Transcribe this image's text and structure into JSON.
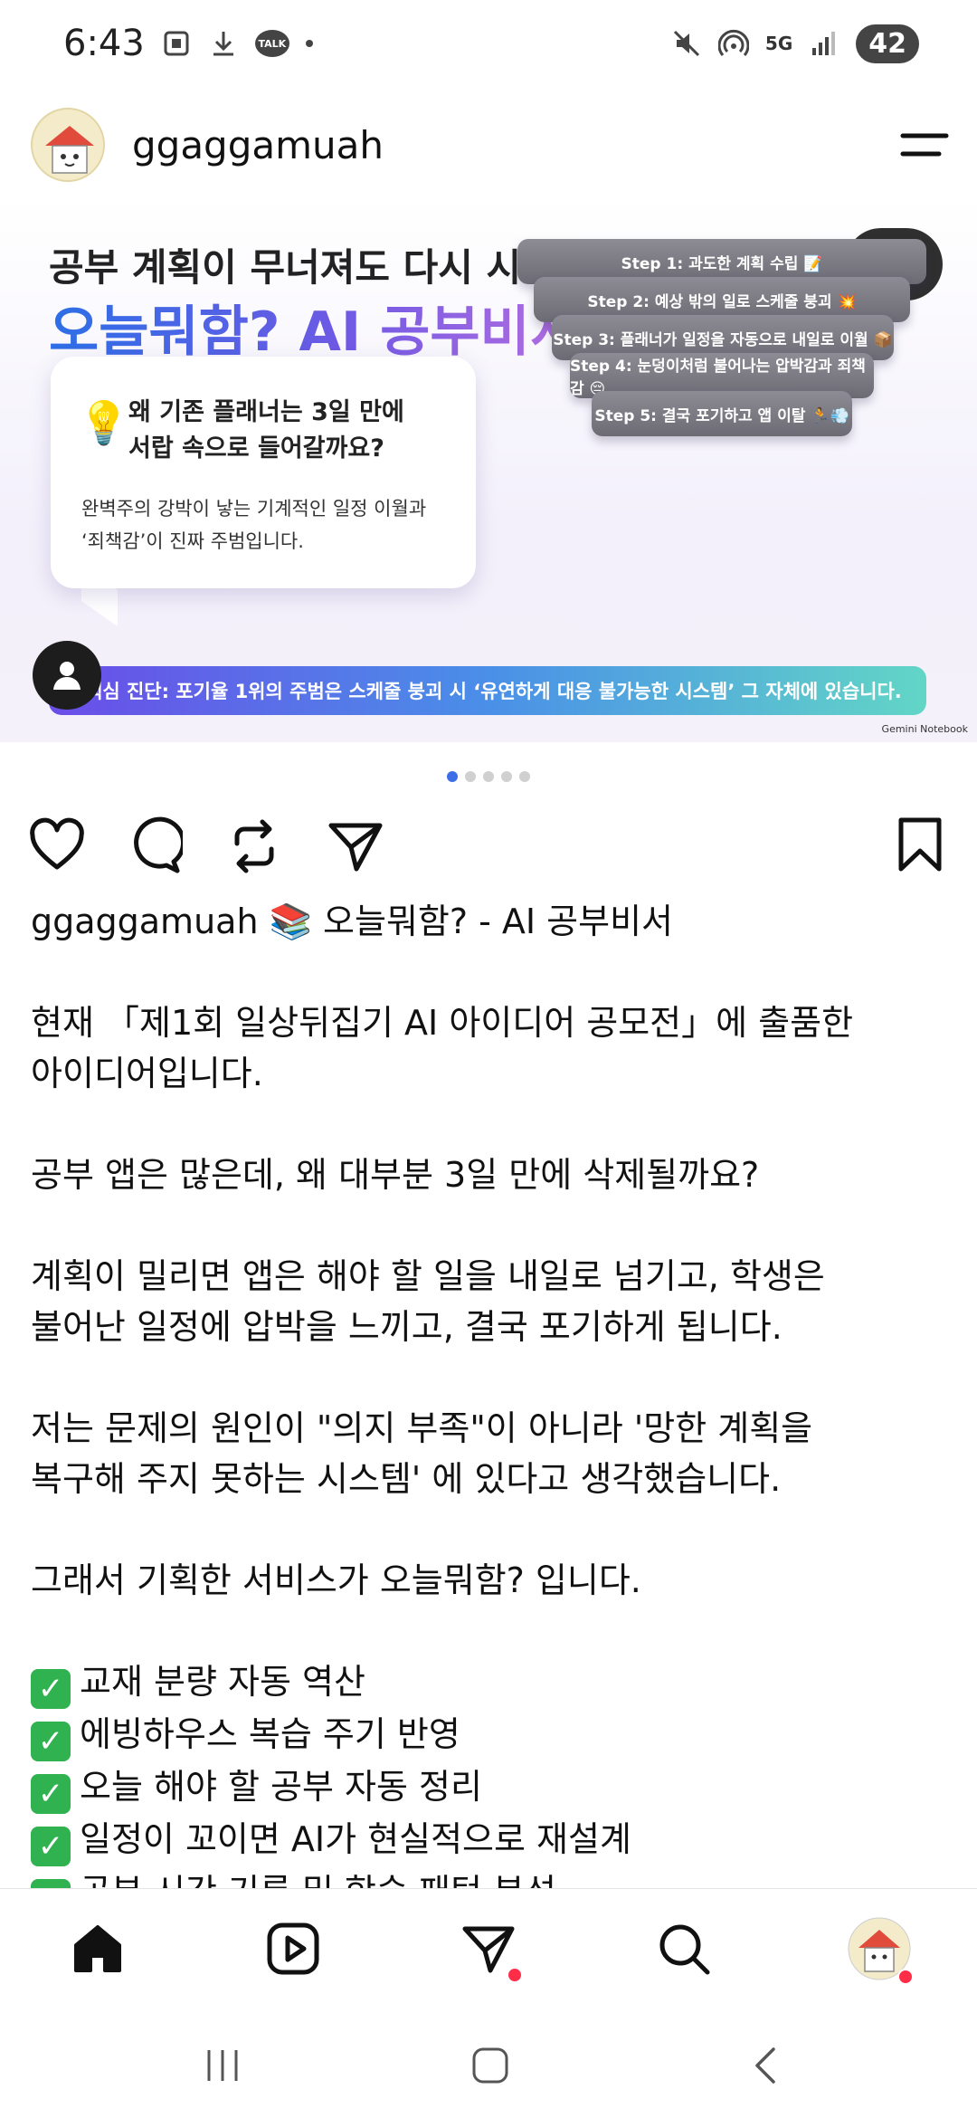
{
  "status_bar": {
    "time": "6:43",
    "talk_badge": "TALK",
    "network": "5G",
    "battery": "42",
    "icons": [
      "screenshot-icon",
      "download-icon",
      "talk-icon",
      "mute-icon",
      "hotspot-icon",
      "signal-icon"
    ]
  },
  "post": {
    "username": "ggaggamuah",
    "carousel": {
      "counter": "1/5",
      "title_line1": "공부 계획이 무너져도 다시 시작하게 만드는",
      "title_line2": "오늘뭐함? AI 공부비서",
      "bubble_question_line1": "왜 기존 플래너는 3일 만에",
      "bubble_question_line2": "서랍 속으로 들어갈까요?",
      "bubble_answer_line1": "완벽주의 강박이 낳는 기계적인 일정 이월과",
      "bubble_answer_line2": "‘죄책감’이 진짜 주범입니다.",
      "steps": [
        "Step 1: 과도한 계획 수립 📝",
        "Step 2: 예상 밖의 일로 스케줄 붕괴 💥",
        "Step 3: 플래너가 일정을 자동으로 내일로 이월 📦",
        "Step 4: 눈덩이처럼 불어나는 압박감과 죄책감 😔",
        "Step 5: 결국 포기하고 앱 이탈 🏃💨"
      ],
      "banner": "핵심 진단: 포기율 1위의 주범은 스케줄 붕괴 시 ‘유연하게 대응 불가능한 시스템’ 그 자체에 있습니다.",
      "watermark": "Gemini Notebook",
      "page_count": 5,
      "active_page": 1
    },
    "caption": {
      "username": "ggaggamuah",
      "headline": "📚 오늘뭐함? - AI 공부비서",
      "para1_line1": "현재 「제1회 일상뒤집기 AI 아이디어 공모전」에 출품한",
      "para1_line2": "아이디어입니다.",
      "para2": "공부 앱은 많은데, 왜 대부분 3일 만에 삭제될까요?",
      "para3_line1": "계획이 밀리면 앱은 해야 할 일을 내일로 넘기고, 학생은",
      "para3_line2": "불어난 일정에 압박을 느끼고, 결국 포기하게 됩니다.",
      "para4_line1": "저는 문제의 원인이 \"의지 부족\"이 아니라 '망한 계획을",
      "para4_line2": "복구해 주지 못하는 시스템' 에 있다고 생각했습니다.",
      "para5": "그래서 기획한 서비스가 오늘뭐함? 입니다.",
      "features": [
        "교재 분량 자동 역산",
        "에빙하우스 복습 주기 반영",
        "오늘 해야 할 공부 자동 정리",
        "일정이 꼬이면 AI가 현실적으로 재설계",
        "공부 시간 기록 및 학습 패턴 분석"
      ]
    }
  },
  "bottom_nav": [
    "home-icon",
    "reels-icon",
    "messages-icon",
    "search-icon",
    "profile-avatar"
  ],
  "colors": {
    "accent_blue": "#3d6ee8",
    "notification_red": "#ff2d48",
    "check_green": "#2fb24f"
  }
}
